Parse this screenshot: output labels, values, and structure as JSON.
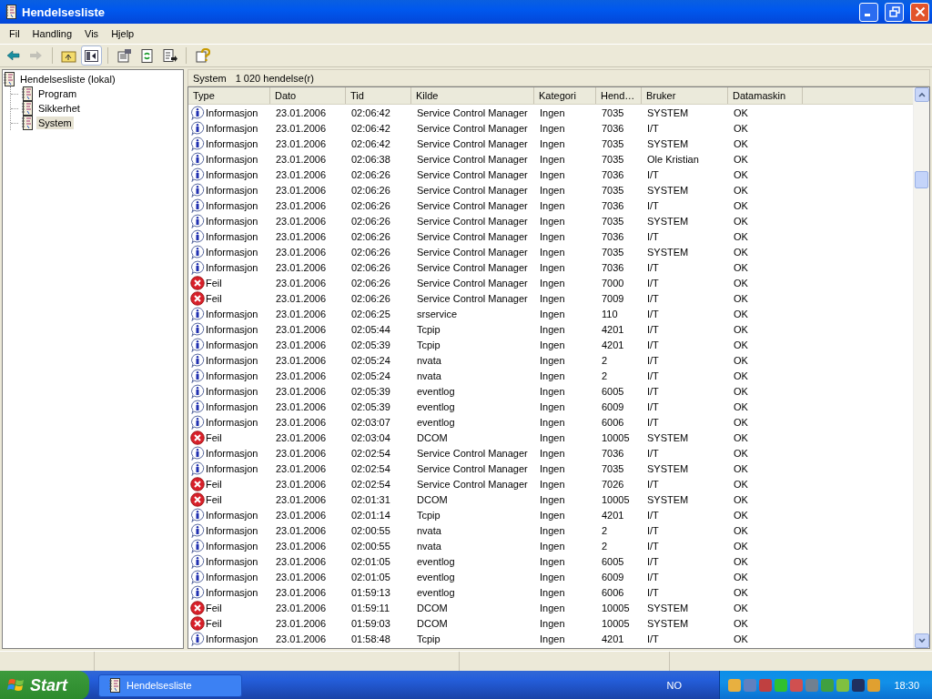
{
  "window": {
    "title": "Hendelsesliste"
  },
  "menu": [
    "Fil",
    "Handling",
    "Vis",
    "Hjelp"
  ],
  "toolbar": [
    {
      "kind": "back",
      "disabled": false,
      "pressed": false
    },
    {
      "kind": "forward",
      "disabled": true,
      "pressed": false
    },
    {
      "kind": "separator"
    },
    {
      "kind": "up",
      "disabled": false,
      "pressed": false
    },
    {
      "kind": "tree",
      "disabled": false,
      "pressed": true
    },
    {
      "kind": "separator"
    },
    {
      "kind": "properties",
      "disabled": false,
      "pressed": false
    },
    {
      "kind": "refresh",
      "disabled": false,
      "pressed": false
    },
    {
      "kind": "export",
      "disabled": false,
      "pressed": false
    },
    {
      "kind": "separator"
    },
    {
      "kind": "help",
      "disabled": false,
      "pressed": false
    }
  ],
  "tree": {
    "label": "Hendelsesliste (lokal)",
    "children": [
      {
        "label": "Program",
        "selected": false
      },
      {
        "label": "Sikkerhet",
        "selected": false
      },
      {
        "label": "System",
        "selected": true
      }
    ]
  },
  "pane_header": {
    "name": "System",
    "count": "1 020 hendelse(r)"
  },
  "table": {
    "columns": [
      "Type",
      "Dato",
      "Tid",
      "Kilde",
      "Kategori",
      "Hend…",
      "Bruker",
      "Datamaskin"
    ],
    "rows": [
      {
        "kind": "info",
        "cells": [
          "Informasjon",
          "23.01.2006",
          "02:06:42",
          "Service Control Manager",
          "Ingen",
          "7035",
          "SYSTEM",
          "OK"
        ]
      },
      {
        "kind": "info",
        "cells": [
          "Informasjon",
          "23.01.2006",
          "02:06:42",
          "Service Control Manager",
          "Ingen",
          "7036",
          "I/T",
          "OK"
        ]
      },
      {
        "kind": "info",
        "cells": [
          "Informasjon",
          "23.01.2006",
          "02:06:42",
          "Service Control Manager",
          "Ingen",
          "7035",
          "SYSTEM",
          "OK"
        ]
      },
      {
        "kind": "info",
        "cells": [
          "Informasjon",
          "23.01.2006",
          "02:06:38",
          "Service Control Manager",
          "Ingen",
          "7035",
          "Ole Kristian",
          "OK"
        ]
      },
      {
        "kind": "info",
        "cells": [
          "Informasjon",
          "23.01.2006",
          "02:06:26",
          "Service Control Manager",
          "Ingen",
          "7036",
          "I/T",
          "OK"
        ]
      },
      {
        "kind": "info",
        "cells": [
          "Informasjon",
          "23.01.2006",
          "02:06:26",
          "Service Control Manager",
          "Ingen",
          "7035",
          "SYSTEM",
          "OK"
        ]
      },
      {
        "kind": "info",
        "cells": [
          "Informasjon",
          "23.01.2006",
          "02:06:26",
          "Service Control Manager",
          "Ingen",
          "7036",
          "I/T",
          "OK"
        ]
      },
      {
        "kind": "info",
        "cells": [
          "Informasjon",
          "23.01.2006",
          "02:06:26",
          "Service Control Manager",
          "Ingen",
          "7035",
          "SYSTEM",
          "OK"
        ]
      },
      {
        "kind": "info",
        "cells": [
          "Informasjon",
          "23.01.2006",
          "02:06:26",
          "Service Control Manager",
          "Ingen",
          "7036",
          "I/T",
          "OK"
        ]
      },
      {
        "kind": "info",
        "cells": [
          "Informasjon",
          "23.01.2006",
          "02:06:26",
          "Service Control Manager",
          "Ingen",
          "7035",
          "SYSTEM",
          "OK"
        ]
      },
      {
        "kind": "info",
        "cells": [
          "Informasjon",
          "23.01.2006",
          "02:06:26",
          "Service Control Manager",
          "Ingen",
          "7036",
          "I/T",
          "OK"
        ]
      },
      {
        "kind": "error",
        "cells": [
          "Feil",
          "23.01.2006",
          "02:06:26",
          "Service Control Manager",
          "Ingen",
          "7000",
          "I/T",
          "OK"
        ]
      },
      {
        "kind": "error",
        "cells": [
          "Feil",
          "23.01.2006",
          "02:06:26",
          "Service Control Manager",
          "Ingen",
          "7009",
          "I/T",
          "OK"
        ]
      },
      {
        "kind": "info",
        "cells": [
          "Informasjon",
          "23.01.2006",
          "02:06:25",
          "srservice",
          "Ingen",
          "110",
          "I/T",
          "OK"
        ]
      },
      {
        "kind": "info",
        "cells": [
          "Informasjon",
          "23.01.2006",
          "02:05:44",
          "Tcpip",
          "Ingen",
          "4201",
          "I/T",
          "OK"
        ]
      },
      {
        "kind": "info",
        "cells": [
          "Informasjon",
          "23.01.2006",
          "02:05:39",
          "Tcpip",
          "Ingen",
          "4201",
          "I/T",
          "OK"
        ]
      },
      {
        "kind": "info",
        "cells": [
          "Informasjon",
          "23.01.2006",
          "02:05:24",
          "nvata",
          "Ingen",
          "2",
          "I/T",
          "OK"
        ]
      },
      {
        "kind": "info",
        "cells": [
          "Informasjon",
          "23.01.2006",
          "02:05:24",
          "nvata",
          "Ingen",
          "2",
          "I/T",
          "OK"
        ]
      },
      {
        "kind": "info",
        "cells": [
          "Informasjon",
          "23.01.2006",
          "02:05:39",
          "eventlog",
          "Ingen",
          "6005",
          "I/T",
          "OK"
        ]
      },
      {
        "kind": "info",
        "cells": [
          "Informasjon",
          "23.01.2006",
          "02:05:39",
          "eventlog",
          "Ingen",
          "6009",
          "I/T",
          "OK"
        ]
      },
      {
        "kind": "info",
        "cells": [
          "Informasjon",
          "23.01.2006",
          "02:03:07",
          "eventlog",
          "Ingen",
          "6006",
          "I/T",
          "OK"
        ]
      },
      {
        "kind": "error",
        "cells": [
          "Feil",
          "23.01.2006",
          "02:03:04",
          "DCOM",
          "Ingen",
          "10005",
          "SYSTEM",
          "OK"
        ]
      },
      {
        "kind": "info",
        "cells": [
          "Informasjon",
          "23.01.2006",
          "02:02:54",
          "Service Control Manager",
          "Ingen",
          "7036",
          "I/T",
          "OK"
        ]
      },
      {
        "kind": "info",
        "cells": [
          "Informasjon",
          "23.01.2006",
          "02:02:54",
          "Service Control Manager",
          "Ingen",
          "7035",
          "SYSTEM",
          "OK"
        ]
      },
      {
        "kind": "error",
        "cells": [
          "Feil",
          "23.01.2006",
          "02:02:54",
          "Service Control Manager",
          "Ingen",
          "7026",
          "I/T",
          "OK"
        ]
      },
      {
        "kind": "error",
        "cells": [
          "Feil",
          "23.01.2006",
          "02:01:31",
          "DCOM",
          "Ingen",
          "10005",
          "SYSTEM",
          "OK"
        ]
      },
      {
        "kind": "info",
        "cells": [
          "Informasjon",
          "23.01.2006",
          "02:01:14",
          "Tcpip",
          "Ingen",
          "4201",
          "I/T",
          "OK"
        ]
      },
      {
        "kind": "info",
        "cells": [
          "Informasjon",
          "23.01.2006",
          "02:00:55",
          "nvata",
          "Ingen",
          "2",
          "I/T",
          "OK"
        ]
      },
      {
        "kind": "info",
        "cells": [
          "Informasjon",
          "23.01.2006",
          "02:00:55",
          "nvata",
          "Ingen",
          "2",
          "I/T",
          "OK"
        ]
      },
      {
        "kind": "info",
        "cells": [
          "Informasjon",
          "23.01.2006",
          "02:01:05",
          "eventlog",
          "Ingen",
          "6005",
          "I/T",
          "OK"
        ]
      },
      {
        "kind": "info",
        "cells": [
          "Informasjon",
          "23.01.2006",
          "02:01:05",
          "eventlog",
          "Ingen",
          "6009",
          "I/T",
          "OK"
        ]
      },
      {
        "kind": "info",
        "cells": [
          "Informasjon",
          "23.01.2006",
          "01:59:13",
          "eventlog",
          "Ingen",
          "6006",
          "I/T",
          "OK"
        ]
      },
      {
        "kind": "error",
        "cells": [
          "Feil",
          "23.01.2006",
          "01:59:11",
          "DCOM",
          "Ingen",
          "10005",
          "SYSTEM",
          "OK"
        ]
      },
      {
        "kind": "error",
        "cells": [
          "Feil",
          "23.01.2006",
          "01:59:03",
          "DCOM",
          "Ingen",
          "10005",
          "SYSTEM",
          "OK"
        ]
      },
      {
        "kind": "info",
        "cells": [
          "Informasjon",
          "23.01.2006",
          "01:58:48",
          "Tcpip",
          "Ingen",
          "4201",
          "I/T",
          "OK"
        ]
      }
    ]
  },
  "taskbar": {
    "start": "Start",
    "tasks": [
      {
        "label": "Hendelsesliste",
        "selected": false
      }
    ],
    "language": "NO",
    "clock": "18:30"
  }
}
